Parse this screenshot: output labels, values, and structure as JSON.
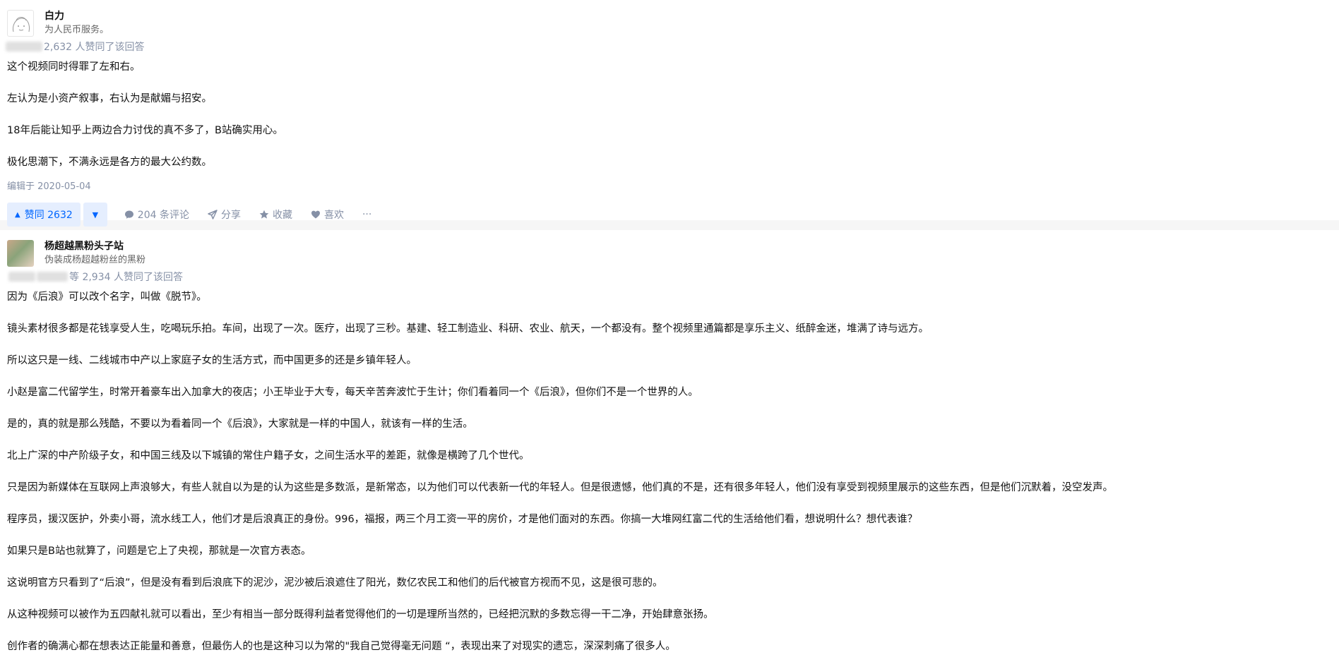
{
  "answer1": {
    "author_name": "白力",
    "author_bio": "为人民币服务。",
    "voters_text": "2,632 人赞同了该回答",
    "paragraphs": [
      "这个视频同时得罪了左和右。",
      "左认为是小资产叙事，右认为是献媚与招安。",
      "18年后能让知乎上两边合力讨伐的真不多了，B站确实用心。",
      "极化思潮下，不满永远是各方的最大公约数。"
    ],
    "edited": "编辑于 2020-05-04",
    "actions": {
      "upvote": "赞同 2632",
      "comments": "204 条评论",
      "share": "分享",
      "collect": "收藏",
      "like": "喜欢",
      "more": "···"
    }
  },
  "answer2": {
    "author_name": "杨超越黑粉头子站",
    "author_bio": "伪装成杨超越粉丝的黑粉",
    "voters_text": "等 2,934 人赞同了该回答",
    "paragraphs": [
      "因为《后浪》可以改个名字，叫做《脱节》。",
      "镜头素材很多都是花钱享受人生，吃喝玩乐拍。车间，出现了一次。医疗，出现了三秒。基建、轻工制造业、科研、农业、航天，一个都没有。整个视频里通篇都是享乐主义、纸醉金迷，堆满了诗与远方。",
      "所以这只是一线、二线城市中产以上家庭子女的生活方式，而中国更多的还是乡镇年轻人。",
      "小赵是富二代留学生，时常开着豪车出入加拿大的夜店；小王毕业于大专，每天辛苦奔波忙于生计；你们看着同一个《后浪》，但你们不是一个世界的人。",
      "是的，真的就是那么残酷，不要以为看着同一个《后浪》，大家就是一样的中国人，就该有一样的生活。",
      "北上广深的中产阶级子女，和中国三线及以下城镇的常住户籍子女，之间生活水平的差距，就像是横跨了几个世代。",
      "只是因为新媒体在互联网上声浪够大，有些人就自以为是的认为这些是多数派，是新常态，以为他们可以代表新一代的年轻人。但是很遗憾，他们真的不是，还有很多年轻人，他们没有享受到视频里展示的这些东西，但是他们沉默着，没空发声。",
      "程序员，援汉医护，外卖小哥，流水线工人，他们才是后浪真正的身份。996，福报，两三个月工资一平的房价，才是他们面对的东西。你搞一大堆网红富二代的生活给他们看，想说明什么？想代表谁？",
      "如果只是B站也就算了，问题是它上了央视，那就是一次官方表态。",
      "这说明官方只看到了“后浪”，但是没有看到后浪底下的泥沙，泥沙被后浪遮住了阳光，数亿农民工和他们的后代被官方视而不见，这是很可悲的。",
      "从这种视频可以被作为五四献礼就可以看出，至少有相当一部分既得利益者觉得他们的一切是理所当然的，已经把沉默的多数忘得一干二净，开始肆意张扬。",
      "创作者的确满心都在想表达正能量和善意，但最伤人的也是这种习以为常的\"我自己觉得毫无问题 “，表现出来了对现实的遗忘，深深刺痛了很多人。"
    ]
  }
}
